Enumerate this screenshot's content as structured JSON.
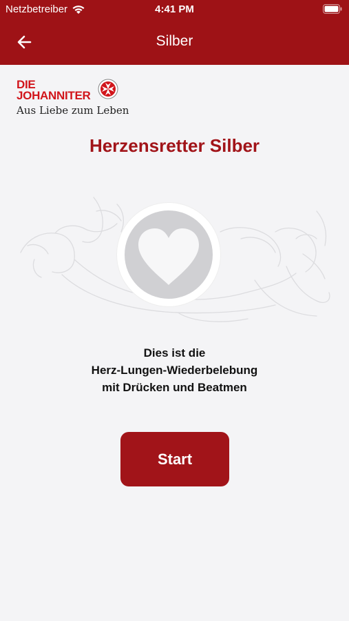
{
  "status_bar": {
    "carrier": "Netzbetreiber",
    "time": "4:41 PM"
  },
  "nav": {
    "title": "Silber",
    "back_icon": "arrow-left-icon"
  },
  "logo": {
    "line1": "DIE",
    "line2": "JOHANNITER",
    "tagline": "Aus Liebe zum Leben"
  },
  "main": {
    "heading": "Herzensretter Silber",
    "description": [
      "Dies ist die",
      "Herz-Lungen-Wiederbelebung",
      "mit Drücken und Beatmen"
    ],
    "start_label": "Start"
  },
  "colors": {
    "brand_red": "#9e1216",
    "heading_red": "#a11419",
    "logo_red": "#d1151b",
    "background": "#f4f4f6"
  }
}
